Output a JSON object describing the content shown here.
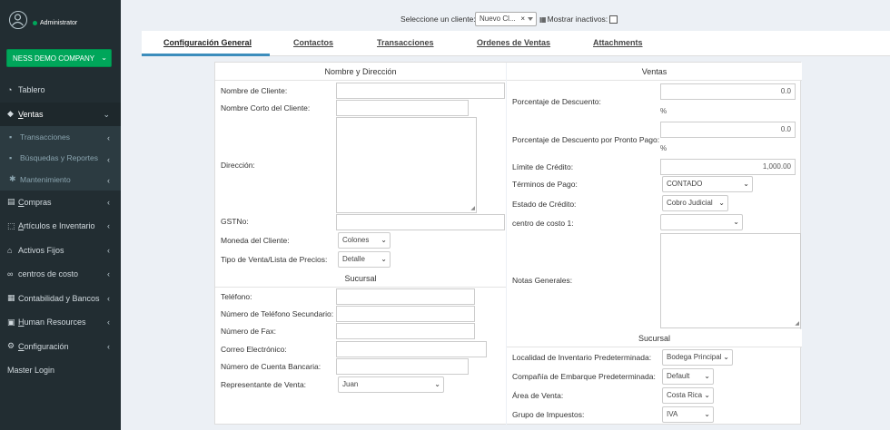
{
  "user": {
    "role": "Administrator"
  },
  "company": {
    "label": "NESS DEMO COMPANY"
  },
  "nav": {
    "tablero": "Tablero",
    "ventas": "Ventas",
    "transacciones": "Transacciones",
    "busquedas": "Búsquedas y Reportes",
    "mantenimiento": "Mantenimiento",
    "compras": "Compras",
    "articulos": "Artículos e Inventario",
    "activos": "Activos Fijos",
    "centros": "centros de costo",
    "contabilidad": "Contabilidad y Bancos",
    "human": "Human Resources",
    "configuracion": "Configuración",
    "master": "Master Login"
  },
  "topbar": {
    "client_label": "Seleccione un cliente:",
    "client_value": "Nuevo Cl...",
    "clear_symbol": "×",
    "inactive_label": "Mostrar inactivos:"
  },
  "tabs": {
    "general": "Configuración General",
    "contactos": "Contactos",
    "transacciones": "Transacciones",
    "ordenes": "Ordenes de Ventas",
    "attachments": "Attachments"
  },
  "left": {
    "header": "Nombre y Dirección",
    "nombre": "Nombre de Cliente:",
    "nombre_corto": "Nombre Corto del Cliente:",
    "direccion": "Dirección:",
    "gst": "GSTNo:",
    "moneda": "Moneda del Cliente:",
    "moneda_value": "Colones",
    "tipo_venta": "Tipo de Venta/Lista de Precios:",
    "tipo_venta_value": "Detalle",
    "sucursal_header": "Sucursal",
    "telefono": "Teléfono:",
    "telefono2": "Número de Teléfono Secundario:",
    "fax": "Número de Fax:",
    "correo": "Correo Electrónico:",
    "cuenta": "Número de Cuenta Bancaria:",
    "representante": "Representante de Venta:",
    "representante_value": "Juan"
  },
  "right": {
    "header": "Ventas",
    "descuento": "Porcentaje de Descuento:",
    "descuento_value": "0.0",
    "pronto_pago": "Porcentaje de Descuento por Pronto Pago:",
    "pronto_pago_value": "0.0",
    "percent": "%",
    "limite": "Límite de Crédito:",
    "limite_value": "1,000.00",
    "terminos": "Términos de Pago:",
    "terminos_value": "CONTADO",
    "estado": "Estado de Crédito:",
    "estado_value": "Cobro Judicial",
    "centro": "centro de costo 1:",
    "notas": "Notas Generales:",
    "sucursal_header": "Sucursal",
    "localidad": "Localidad de Inventario Predeterminada:",
    "localidad_value": "Bodega Principal",
    "embarque": "Compañía de Embarque Predeterminada:",
    "embarque_value": "Default",
    "area": "Área de Venta:",
    "area_value": "Costa Rica",
    "impuestos": "Grupo de Impuestos:",
    "impuestos_value": "IVA"
  }
}
